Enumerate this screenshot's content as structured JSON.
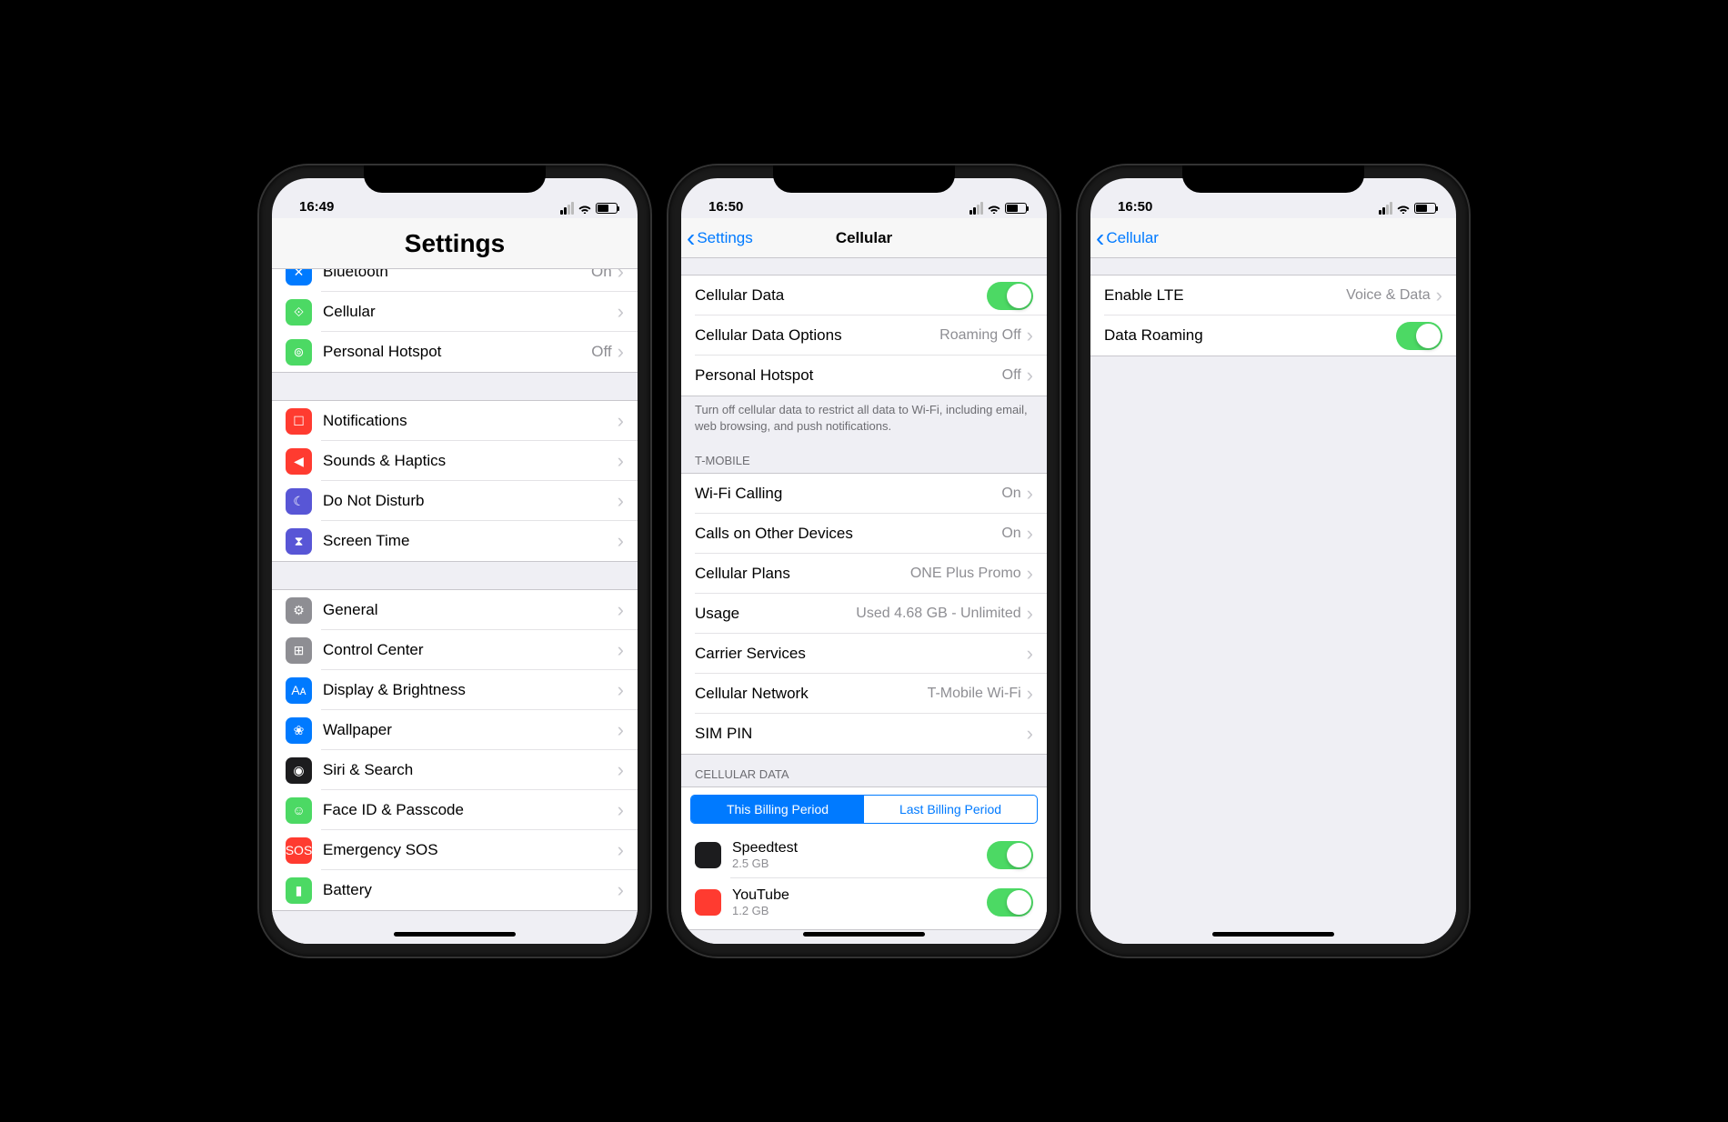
{
  "screen1": {
    "time": "16:49",
    "title": "Settings",
    "rows_g1": [
      {
        "icon": "bluetooth",
        "bg": "bg-blue",
        "label": "Bluetooth",
        "value": "On"
      },
      {
        "icon": "cellular",
        "bg": "bg-green",
        "label": "Cellular",
        "value": ""
      },
      {
        "icon": "hotspot",
        "bg": "bg-green",
        "label": "Personal Hotspot",
        "value": "Off"
      }
    ],
    "rows_g2": [
      {
        "icon": "notify",
        "bg": "bg-red",
        "label": "Notifications",
        "value": ""
      },
      {
        "icon": "sound",
        "bg": "bg-red",
        "label": "Sounds & Haptics",
        "value": ""
      },
      {
        "icon": "moon",
        "bg": "bg-purple",
        "label": "Do Not Disturb",
        "value": ""
      },
      {
        "icon": "hourglass",
        "bg": "bg-purple",
        "label": "Screen Time",
        "value": ""
      }
    ],
    "rows_g3": [
      {
        "icon": "gear",
        "bg": "bg-gray",
        "label": "General",
        "value": ""
      },
      {
        "icon": "control",
        "bg": "bg-gray",
        "label": "Control Center",
        "value": ""
      },
      {
        "icon": "display",
        "bg": "bg-blue",
        "label": "Display & Brightness",
        "value": ""
      },
      {
        "icon": "wallpaper",
        "bg": "bg-blue",
        "label": "Wallpaper",
        "value": ""
      },
      {
        "icon": "siri",
        "bg": "bg-black",
        "label": "Siri & Search",
        "value": ""
      },
      {
        "icon": "faceid",
        "bg": "bg-green",
        "label": "Face ID & Passcode",
        "value": ""
      },
      {
        "icon": "sos",
        "bg": "bg-red",
        "label": "Emergency SOS",
        "value": ""
      },
      {
        "icon": "battery",
        "bg": "bg-green",
        "label": "Battery",
        "value": ""
      }
    ]
  },
  "screen2": {
    "time": "16:50",
    "back": "Settings",
    "title": "Cellular",
    "rows_g1": [
      {
        "label": "Cellular Data",
        "toggle": true,
        "on": true
      },
      {
        "label": "Cellular Data Options",
        "value": "Roaming Off",
        "chev": true
      },
      {
        "label": "Personal Hotspot",
        "value": "Off",
        "chev": true
      }
    ],
    "footer1": "Turn off cellular data to restrict all data to Wi-Fi, including email, web browsing, and push notifications.",
    "section_carrier": "T-MOBILE",
    "rows_g2": [
      {
        "label": "Wi-Fi Calling",
        "value": "On",
        "chev": true
      },
      {
        "label": "Calls on Other Devices",
        "value": "On",
        "chev": true
      },
      {
        "label": "Cellular Plans",
        "value": "ONE Plus Promo",
        "chev": true
      },
      {
        "label": "Usage",
        "value": "Used 4.68 GB - Unlimited",
        "chev": true
      },
      {
        "label": "Carrier Services",
        "value": "",
        "chev": true
      },
      {
        "label": "Cellular Network",
        "value": "T-Mobile Wi-Fi",
        "chev": true
      },
      {
        "label": "SIM PIN",
        "value": "",
        "chev": true
      }
    ],
    "section_data": "CELLULAR DATA",
    "segments": [
      "This Billing Period",
      "Last Billing Period"
    ],
    "apps": [
      {
        "name": "Speedtest",
        "sub": "2.5 GB",
        "bg": "bg-black",
        "on": true
      },
      {
        "name": "YouTube",
        "sub": "1.2 GB",
        "bg": "bg-red",
        "on": true
      }
    ]
  },
  "screen3": {
    "time": "16:50",
    "back": "Cellular",
    "rows": [
      {
        "label": "Enable LTE",
        "value": "Voice & Data",
        "chev": true
      },
      {
        "label": "Data Roaming",
        "toggle": true,
        "on": true
      }
    ]
  }
}
